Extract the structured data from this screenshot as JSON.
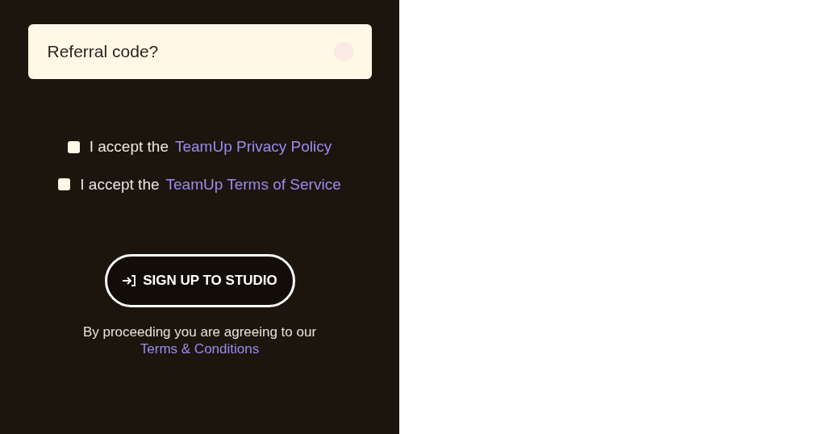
{
  "referral_field": {
    "placeholder": "Referral code?"
  },
  "agreements": [
    {
      "prefix": "I accept the",
      "link": "TeamUp Privacy Policy",
      "checked": false
    },
    {
      "prefix": "I accept the",
      "link": "TeamUp Terms of Service",
      "checked": false
    }
  ],
  "signup_button": {
    "label": "SIGN UP TO STUDIO"
  },
  "footer": {
    "text": "By proceeding you are agreeing to our",
    "link": "Terms & Conditions"
  }
}
